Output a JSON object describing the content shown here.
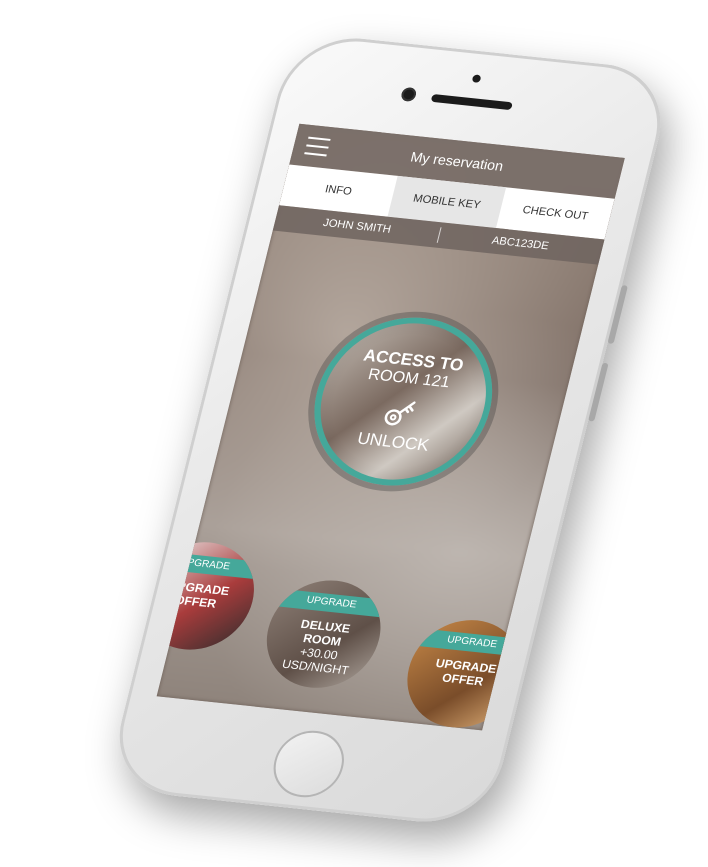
{
  "header": {
    "title": "My reservation"
  },
  "tabs": [
    {
      "label": "INFO"
    },
    {
      "label": "MOBILE KEY"
    },
    {
      "label": "CHECK OUT"
    }
  ],
  "reservation": {
    "guest_name": "JOHN SMITH",
    "code": "ABC123DE"
  },
  "key": {
    "line1": "ACCESS TO",
    "line2": "ROOM 121",
    "action": "UNLOCK"
  },
  "offers": [
    {
      "tag": "UPGRADE",
      "title": "UPGRADE",
      "subtitle": "OFFER",
      "price": ""
    },
    {
      "tag": "UPGRADE",
      "title": "DELUXE",
      "subtitle": "ROOM",
      "price": "+30.00",
      "unit": "USD/NIGHT"
    },
    {
      "tag": "UPGRADE",
      "title": "UPGRADE",
      "subtitle": "OFFER",
      "price": ""
    }
  ],
  "colors": {
    "accent": "#45a89a",
    "topbar": "#786e68",
    "tab_active": "#e6e6e6"
  },
  "icons": {
    "menu": "hamburger-menu-icon",
    "key": "key-icon"
  }
}
